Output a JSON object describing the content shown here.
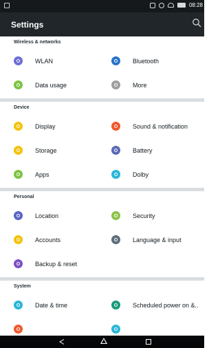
{
  "status_bar": {
    "time": "08:28",
    "icons": [
      "lock-icon",
      "vibrate-icon",
      "alarm-icon",
      "wifi-icon",
      "battery-icon"
    ]
  },
  "app_bar": {
    "title": "Settings",
    "search_icon": "search-icon"
  },
  "sections": {
    "wireless": {
      "title": "Wireless & networks",
      "items": [
        {
          "label": "WLAN",
          "icon": "wifi-icon",
          "color": "#6b6fd6"
        },
        {
          "label": "Bluetooth",
          "icon": "bluetooth-icon",
          "color": "#2b73c8"
        },
        {
          "label": "Data usage",
          "icon": "data-usage-icon",
          "color": "#7cc342"
        },
        {
          "label": "More",
          "icon": "more-icon",
          "color": "#9e9e9e"
        }
      ]
    },
    "device": {
      "title": "Device",
      "items": [
        {
          "label": "Display",
          "icon": "display-icon",
          "color": "#f4c20d"
        },
        {
          "label": "Sound & notification",
          "icon": "bell-icon",
          "color": "#f0592b"
        },
        {
          "label": "Storage",
          "icon": "storage-icon",
          "color": "#f4c20d"
        },
        {
          "label": "Battery",
          "icon": "battery-icon",
          "color": "#5a6bb3"
        },
        {
          "label": "Apps",
          "icon": "android-icon",
          "color": "#7cc342"
        },
        {
          "label": "Dolby",
          "icon": "dolby-icon",
          "color": "#29b6d8"
        }
      ]
    },
    "personal": {
      "title": "Personal",
      "items": [
        {
          "label": "Location",
          "icon": "location-icon",
          "color": "#5a64c8"
        },
        {
          "label": "Security",
          "icon": "security-icon",
          "color": "#8bc34a"
        },
        {
          "label": "Accounts",
          "icon": "accounts-icon",
          "color": "#f4c20d"
        },
        {
          "label": "Language & input",
          "icon": "language-icon",
          "color": "#5d6f7d"
        },
        {
          "label": "Backup & reset",
          "icon": "backup-icon",
          "color": "#7c4fc6"
        }
      ]
    },
    "system": {
      "title": "System",
      "items": [
        {
          "label": "Date & time",
          "icon": "clock-icon",
          "color": "#29b6d8"
        },
        {
          "label": "Scheduled power on &..",
          "icon": "scheduled-power-icon",
          "color": "#1a9a7a"
        },
        {
          "label": "",
          "icon": "accessibility-icon",
          "color": "#f0592b"
        },
        {
          "label": "",
          "icon": "printing-icon",
          "color": "#29b6d8"
        }
      ]
    }
  },
  "nav_bar": {
    "back": "back-icon",
    "home": "home-icon",
    "recents": "recents-icon"
  }
}
